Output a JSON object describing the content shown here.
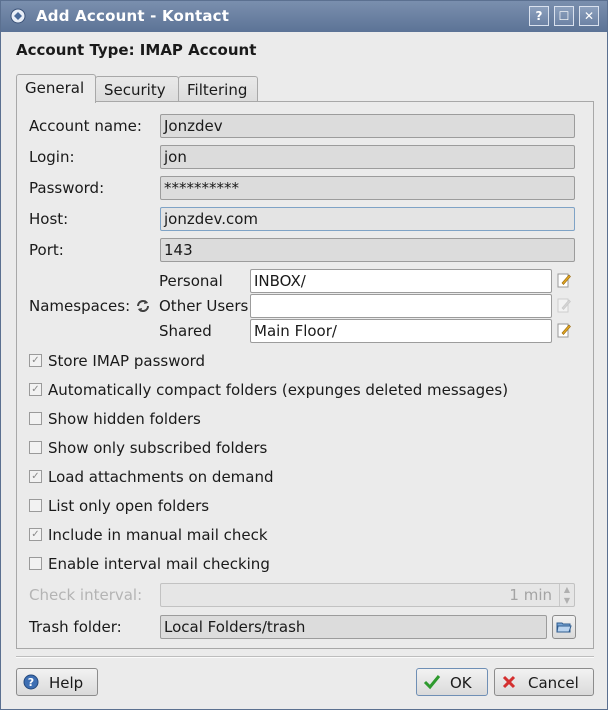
{
  "window": {
    "title": "Add Account - Kontact",
    "help_glyph": "?",
    "max_glyph": "☐",
    "close_glyph": "✕"
  },
  "heading": "Account Type: IMAP Account",
  "tabs": [
    "General",
    "Security",
    "Filtering"
  ],
  "form": {
    "account_name": {
      "label": "Account name:",
      "value": "Jonzdev"
    },
    "login": {
      "label": "Login:",
      "value": "jon"
    },
    "password": {
      "label": "Password:",
      "value": "**********"
    },
    "host": {
      "label": "Host:",
      "value": "jonzdev.com"
    },
    "port": {
      "label": "Port:",
      "value": "143"
    }
  },
  "namespaces": {
    "label": "Namespaces:",
    "personal": {
      "label": "Personal",
      "value": "INBOX/"
    },
    "other_users": {
      "label": "Other Users",
      "value": ""
    },
    "shared": {
      "label": "Shared",
      "value": "Main Floor/"
    }
  },
  "checkboxes": [
    {
      "label": "Store IMAP password",
      "checked": true
    },
    {
      "label": "Automatically compact folders (expunges deleted messages)",
      "checked": true
    },
    {
      "label": "Show hidden folders",
      "checked": false
    },
    {
      "label": "Show only subscribed folders",
      "checked": false
    },
    {
      "label": "Load attachments on demand",
      "checked": true
    },
    {
      "label": "List only open folders",
      "checked": false
    },
    {
      "label": "Include in manual mail check",
      "checked": true
    },
    {
      "label": "Enable interval mail checking",
      "checked": false
    }
  ],
  "check_interval": {
    "label": "Check interval:",
    "value": "1 min"
  },
  "trash_folder": {
    "label": "Trash folder:",
    "value": "Local Folders/trash"
  },
  "buttons": {
    "help": "Help",
    "ok": "OK",
    "cancel": "Cancel"
  }
}
